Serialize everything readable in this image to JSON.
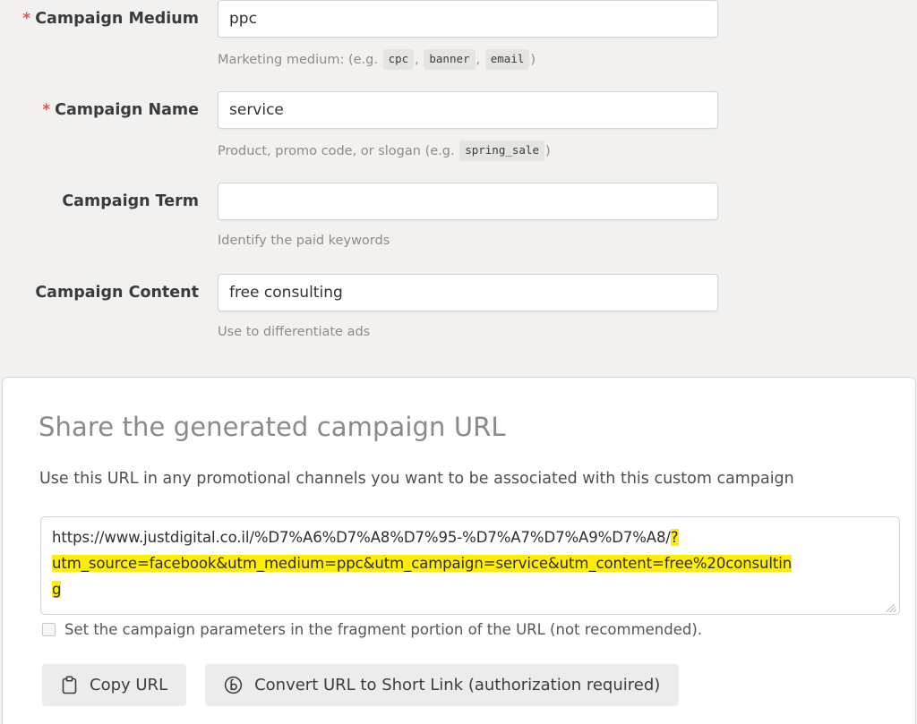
{
  "form": {
    "fields": [
      {
        "label": "Campaign Medium",
        "required": true,
        "value": "ppc",
        "placeholder": "",
        "help_prefix": "Marketing medium: (e.g.",
        "help_chips": [
          "cpc",
          "banner",
          "email"
        ],
        "help_suffix": ")"
      },
      {
        "label": "Campaign Name",
        "required": true,
        "value": "service",
        "placeholder": "",
        "help_prefix": "Product, promo code, or slogan (e.g.",
        "help_chips": [
          "spring_sale"
        ],
        "help_suffix": ")"
      },
      {
        "label": "Campaign Term",
        "required": false,
        "value": "",
        "placeholder": "",
        "help_prefix": "Identify the paid keywords",
        "help_chips": [],
        "help_suffix": ""
      },
      {
        "label": "Campaign Content",
        "required": false,
        "value": "free consulting",
        "placeholder": "",
        "help_prefix": "Use to differentiate ads",
        "help_chips": [],
        "help_suffix": ""
      }
    ],
    "required_marker": "*"
  },
  "share": {
    "title": "Share the generated campaign URL",
    "subtitle": "Use this URL in any promotional channels you want to be associated with this custom campaign",
    "url_full": "https://www.justdigital.co.il/%D7%A6%D7%A8%D7%95-%D7%A7%D7%A9%D7%A8/?utm_source=facebook&utm_medium=ppc&utm_campaign=service&utm_content=free%20consulting",
    "url_lines": [
      {
        "plain": "https://www.justdigital.co.il/%D7%A6%D7%A8%D7%95-%D7%A7%D7%A9%D7%A8/",
        "highlighted": "?"
      },
      {
        "plain": "",
        "highlighted": "utm_source=facebook&utm_medium=ppc&utm_campaign=service&utm_content=free%20consultin"
      },
      {
        "plain": "",
        "highlighted": "g"
      }
    ],
    "highlight_color": "#ffee00",
    "fragment_checkbox_label": "Set the campaign parameters in the fragment portion of the URL (not recommended).",
    "fragment_checkbox_checked": false,
    "buttons": [
      {
        "label": "Copy URL",
        "icon": "clipboard-icon"
      },
      {
        "label": "Convert URL to Short Link (authorization required)",
        "icon": "bitly-icon"
      }
    ]
  },
  "colors": {
    "page_background": "#f2f1ef",
    "card_background": "#ffffff",
    "required_star": "#e35252",
    "help_text": "#8e8b87",
    "button_background": "#ececec"
  }
}
